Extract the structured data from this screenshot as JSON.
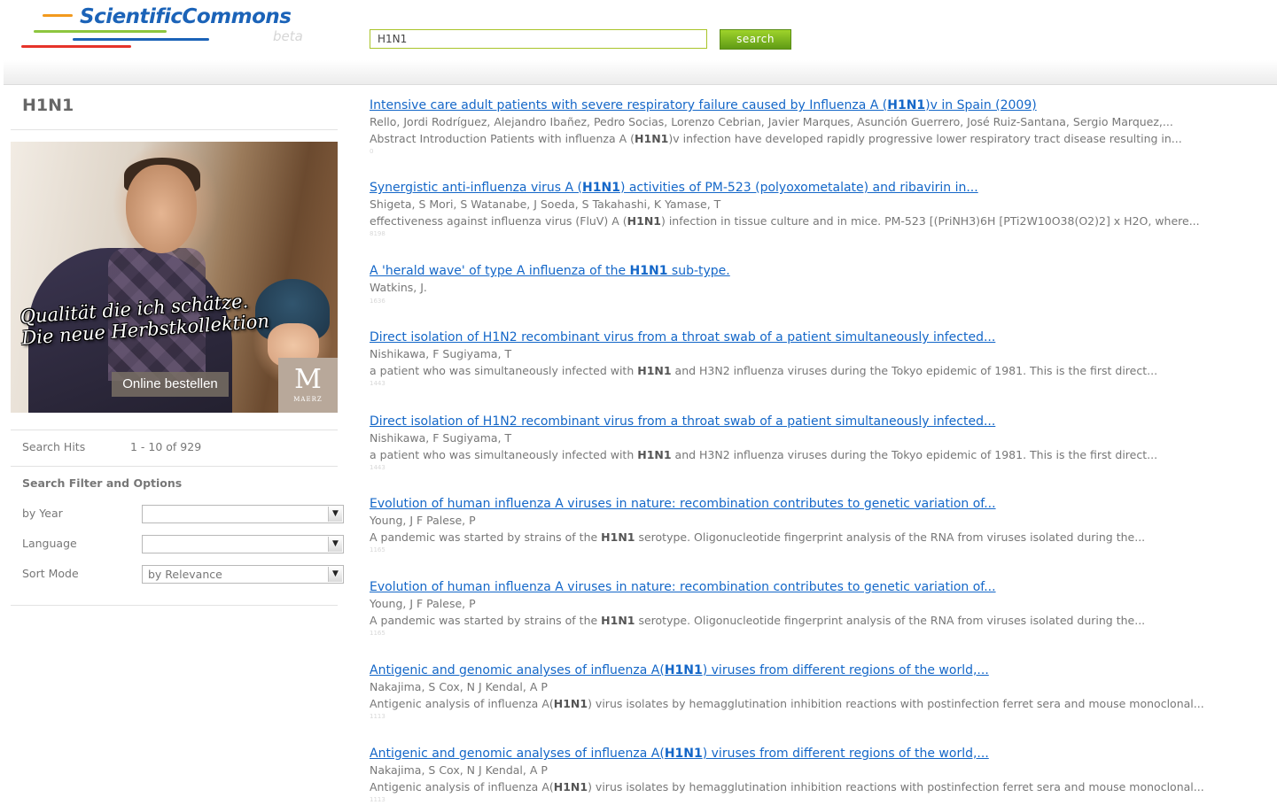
{
  "brand": {
    "name": "ScientificCommons",
    "tag": "beta"
  },
  "search": {
    "value": "H1N1",
    "button_label": "search"
  },
  "sidebar": {
    "query_title": "H1N1",
    "ad": {
      "slogan_line1": "Qualität die ich schätze.",
      "slogan_line2": "Die neue Herbstkollektion",
      "order_button": "Online bestellen",
      "brand_letter": "M",
      "brand_name": "MAERZ"
    },
    "search_hits": {
      "label": "Search Hits",
      "value": "1 - 10 of 929"
    },
    "filter_heading": "Search Filter and Options",
    "filters": [
      {
        "label": "by Year",
        "value": ""
      },
      {
        "label": "Language",
        "value": ""
      },
      {
        "label": "Sort Mode",
        "value": "by Relevance"
      }
    ]
  },
  "results": [
    {
      "title_parts": [
        "Intensive care adult patients with severe respiratory failure caused by Influenza A (",
        "H1N1",
        ")v in Spain (2009)"
      ],
      "authors": "Rello, Jordi Rodríguez, Alejandro Ibañez, Pedro Socias, Lorenzo Cebrian, Javier Marques, Asunción Guerrero, José Ruiz-Santana, Sergio Marquez,...",
      "abstract_parts": [
        "Abstract Introduction Patients with influenza A (",
        "H1N1",
        ")v infection have developed rapidly progressive lower respiratory tract disease resulting in..."
      ],
      "id": "0"
    },
    {
      "title_parts": [
        "Synergistic anti-influenza virus A (",
        "H1N1",
        ") activities of PM-523 (polyoxometalate) and ribavirin in..."
      ],
      "authors": "Shigeta, S Mori, S Watanabe, J Soeda, S Takahashi, K Yamase, T",
      "abstract_parts": [
        "effectiveness against influenza virus (FluV) A (",
        "H1N1",
        ") infection in tissue culture and in mice. PM-523 [(PriNH3)6H [PTi2W10O38(O2)2] x H2O, where..."
      ],
      "id": "8198"
    },
    {
      "title_parts": [
        "A 'herald wave' of type A influenza of the ",
        "H1N1",
        " sub-type."
      ],
      "authors": "Watkins, J.",
      "abstract_parts": [
        "",
        "",
        ""
      ],
      "id": "1636"
    },
    {
      "title_parts": [
        "Direct isolation of H1N2 recombinant virus from a throat swab of a patient simultaneously infected...",
        "",
        ""
      ],
      "authors": "Nishikawa, F Sugiyama, T",
      "abstract_parts": [
        "a patient who was simultaneously infected with ",
        "H1N1",
        " and H3N2 influenza viruses during the Tokyo epidemic of 1981. This is the first direct..."
      ],
      "id": "1443"
    },
    {
      "title_parts": [
        "Direct isolation of H1N2 recombinant virus from a throat swab of a patient simultaneously infected...",
        "",
        ""
      ],
      "authors": "Nishikawa, F Sugiyama, T",
      "abstract_parts": [
        "a patient who was simultaneously infected with ",
        "H1N1",
        " and H3N2 influenza viruses during the Tokyo epidemic of 1981. This is the first direct..."
      ],
      "id": "1443"
    },
    {
      "title_parts": [
        "Evolution of human influenza A viruses in nature: recombination contributes to genetic variation of...",
        "",
        ""
      ],
      "authors": "Young, J F Palese, P",
      "abstract_parts": [
        "A pandemic was started by strains of the ",
        "H1N1",
        " serotype. Oligonucleotide fingerprint analysis of the RNA from viruses isolated during the..."
      ],
      "id": "1165"
    },
    {
      "title_parts": [
        "Evolution of human influenza A viruses in nature: recombination contributes to genetic variation of...",
        "",
        ""
      ],
      "authors": "Young, J F Palese, P",
      "abstract_parts": [
        "A pandemic was started by strains of the ",
        "H1N1",
        " serotype. Oligonucleotide fingerprint analysis of the RNA from viruses isolated during the..."
      ],
      "id": "1165"
    },
    {
      "title_parts": [
        "Antigenic and genomic analyses of influenza A(",
        "H1N1",
        ") viruses from different regions of the world,..."
      ],
      "authors": "Nakajima, S Cox, N J Kendal, A P",
      "abstract_parts": [
        "Antigenic analysis of influenza A(",
        "H1N1",
        ") virus isolates by hemagglutination inhibition reactions with postinfection ferret sera and mouse monoclonal..."
      ],
      "id": "1113"
    },
    {
      "title_parts": [
        "Antigenic and genomic analyses of influenza A(",
        "H1N1",
        ") viruses from different regions of the world,..."
      ],
      "authors": "Nakajima, S Cox, N J Kendal, A P",
      "abstract_parts": [
        "Antigenic analysis of influenza A(",
        "H1N1",
        ") virus isolates by hemagglutination inhibition reactions with postinfection ferret sera and mouse monoclonal..."
      ],
      "id": "1113"
    }
  ]
}
